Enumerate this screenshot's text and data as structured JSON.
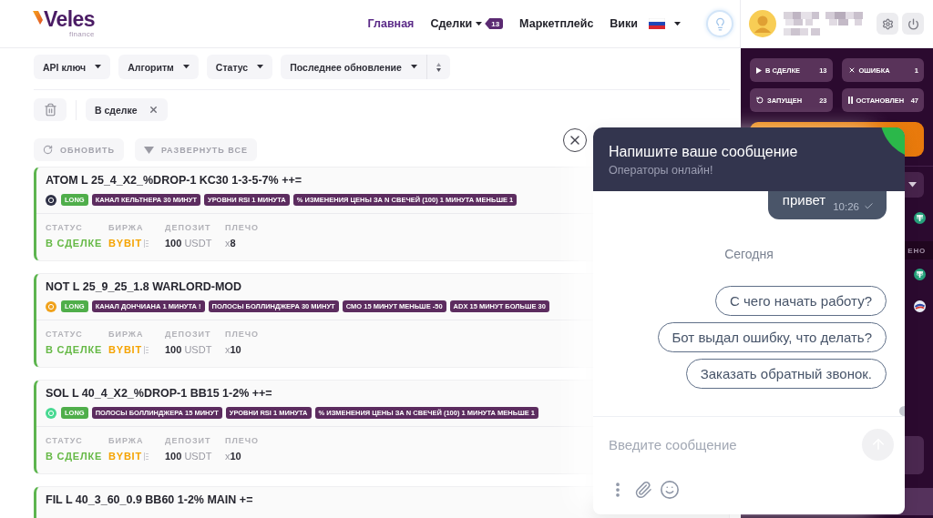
{
  "header": {
    "logo": {
      "name": "Veles",
      "tagline": "finance"
    },
    "nav": [
      {
        "label": "Главная",
        "selected": true
      },
      {
        "label": "Сделки",
        "selected": false,
        "dropdown": true,
        "badge": "13"
      },
      {
        "label": "Маркетплейс",
        "selected": false
      },
      {
        "label": "Вики",
        "selected": false
      }
    ]
  },
  "filters": [
    {
      "label": "API ключ"
    },
    {
      "label": "Алгоритм"
    },
    {
      "label": "Статус"
    },
    {
      "label": "Последнее обновление",
      "sortable": true
    }
  ],
  "active_filters": [
    {
      "label": "В сделке"
    }
  ],
  "actions": [
    {
      "kind": "refresh",
      "label": "ОБНОВИТЬ"
    },
    {
      "kind": "expand",
      "label": "РАЗВЕРНУТЬ ВСЕ"
    }
  ],
  "bots": [
    {
      "title": "ATOM L 25_4_X2_%DROP-1 KC30 1-3-5-7% ++=",
      "color": "#2f3146",
      "side": "LONG",
      "tags": [
        "КАНАЛ КЕЛЬТНЕРА 30 МИНУТ",
        "УРОВНИ RSI 1 МИНУТА",
        "% ИЗМЕНЕНИЯ ЦЕНЫ ЗА N СВЕЧЕЙ (100) 1 МИНУТА МЕНЬШЕ 1"
      ],
      "fields": [
        {
          "kind": "status",
          "label": "СТАТУС",
          "value": "В СДЕЛКЕ"
        },
        {
          "kind": "exchange",
          "label": "БИРЖА",
          "value": "BYBIT"
        },
        {
          "kind": "amount",
          "label": "ДЕПОЗИТ",
          "value": "100",
          "unit": "USDT"
        },
        {
          "kind": "leverage",
          "label": "ПЛЕЧО",
          "prefix": "x",
          "value": "8"
        }
      ]
    },
    {
      "title": "NOT L 25_9_25_1.8 WARLORD-MOD",
      "color": "#f0a21c",
      "side": "LONG",
      "tags": [
        "КАНАЛ ДОНЧИАНА 1 МИНУТА !",
        "ПОЛОСЫ БОЛЛИНДЖЕРА 30 МИНУТ",
        "CMO 15 МИНУТ МЕНЬШЕ -50",
        "ADX 15 МИНУТ БОЛЬШЕ 30"
      ],
      "fields": [
        {
          "kind": "status",
          "label": "СТАТУС",
          "value": "В СДЕЛКЕ"
        },
        {
          "kind": "exchange",
          "label": "БИРЖА",
          "value": "BYBIT"
        },
        {
          "kind": "amount",
          "label": "ДЕПОЗИТ",
          "value": "100",
          "unit": "USDT"
        },
        {
          "kind": "leverage",
          "label": "ПЛЕЧО",
          "prefix": "x",
          "value": "10"
        }
      ]
    },
    {
      "title": "SOL L 40_4_X2_%DROP-1 BB15 1-2% ++=",
      "color": "#48d992",
      "side": "LONG",
      "tags": [
        "ПОЛОСЫ БОЛЛИНДЖЕРА 15 МИНУТ",
        "УРОВНИ RSI 1 МИНУТА",
        "% ИЗМЕНЕНИЯ ЦЕНЫ ЗА N СВЕЧЕЙ (100) 1 МИНУТА МЕНЬШЕ 1"
      ],
      "fields": [
        {
          "kind": "status",
          "label": "СТАТУС",
          "value": "В СДЕЛКЕ"
        },
        {
          "kind": "exchange",
          "label": "БИРЖА",
          "value": "BYBIT"
        },
        {
          "kind": "amount",
          "label": "ДЕПОЗИТ",
          "value": "100",
          "unit": "USDT"
        },
        {
          "kind": "leverage",
          "label": "ПЛЕЧО",
          "prefix": "x",
          "value": "10"
        }
      ]
    },
    {
      "title": "FIL L 40_3_60_0.9 BB60 1-2% MAIN +="
    }
  ],
  "sidebar": {
    "counters": [
      {
        "kind": "in_deal",
        "label": "В СДЕЛКЕ",
        "count": "13"
      },
      {
        "kind": "error",
        "label": "ОШИБКА",
        "count": "1"
      },
      {
        "kind": "running",
        "label": "ЗАПУЩЕН",
        "count": "23"
      },
      {
        "kind": "stopped",
        "label": "ОСТАНОВЛЕН",
        "count": "47"
      }
    ],
    "column_header": "ЕНО"
  },
  "chat": {
    "title": "Напишите ваше сообщение",
    "subtitle": "Операторы онлайн!",
    "messages": [
      {
        "text": "привет",
        "time": "10:26",
        "read": true
      }
    ],
    "date_divider": "Сегодня",
    "quick_replies": [
      "С чего начать работу?",
      "Бот выдал ошибку, что делать?",
      "Заказать обратный звонок."
    ],
    "input": {
      "placeholder": "Введите сообщение"
    }
  }
}
